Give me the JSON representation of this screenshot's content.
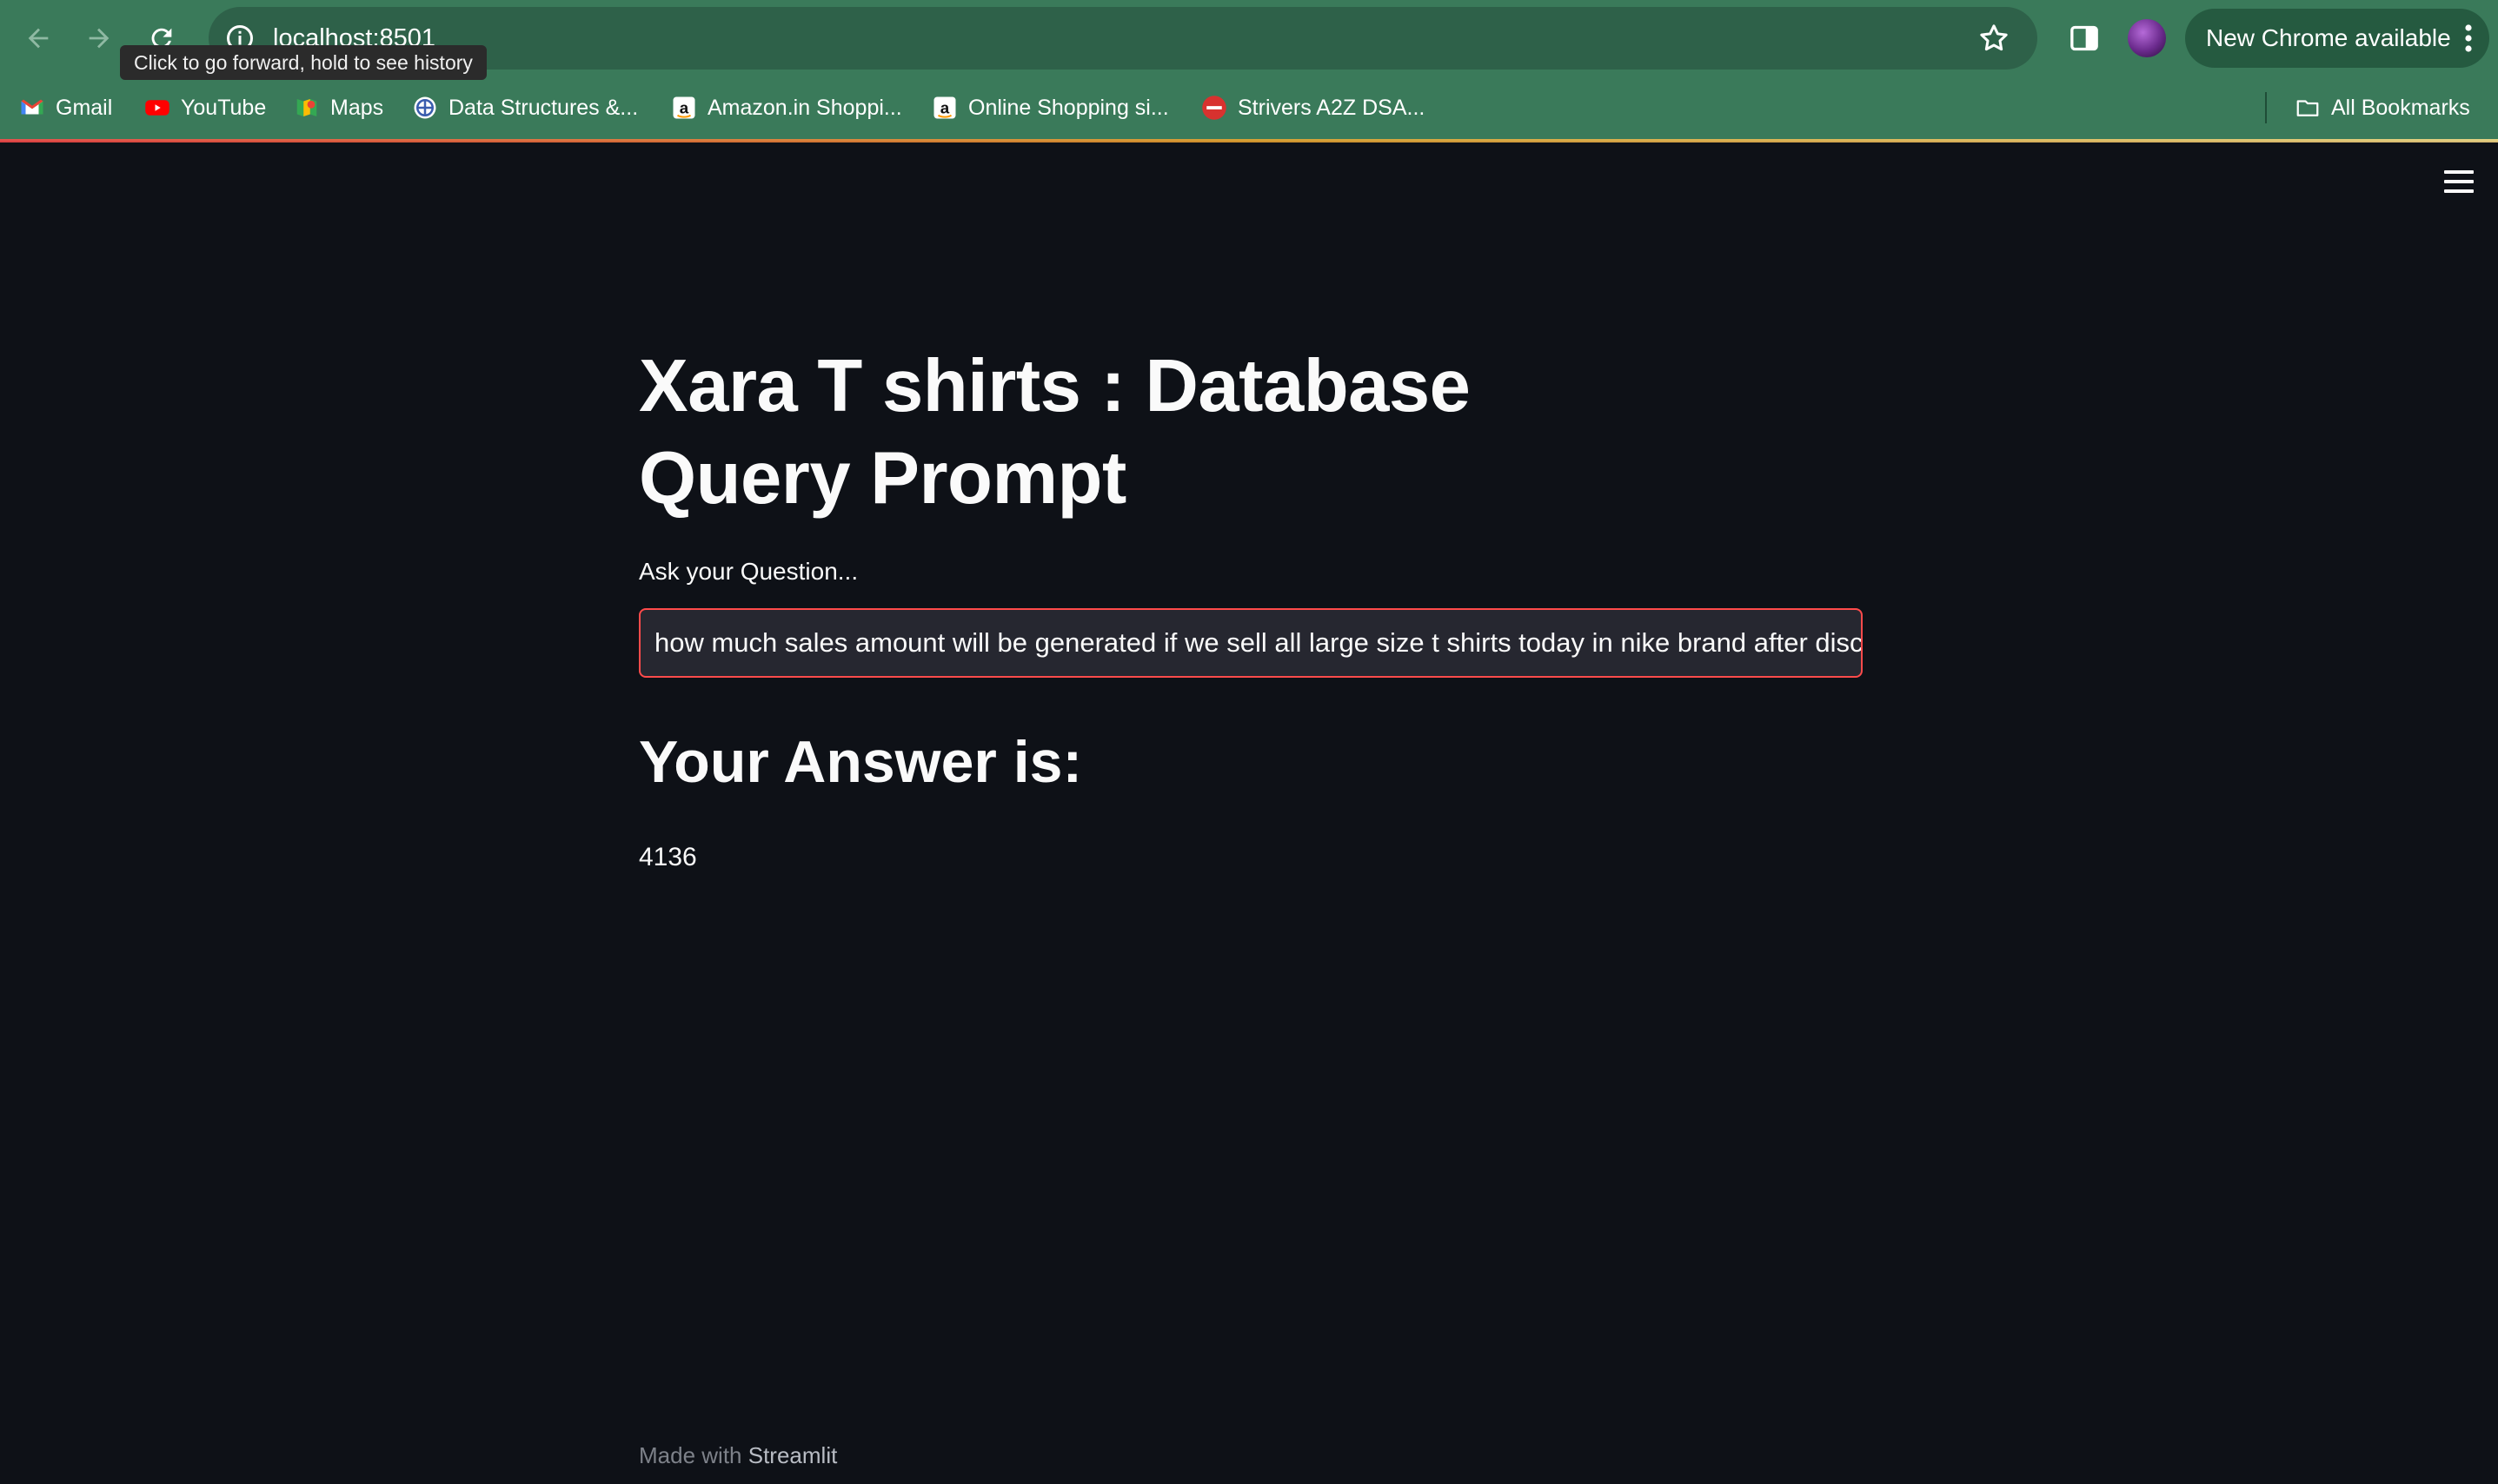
{
  "browser": {
    "url": "localhost:8501",
    "tooltip": "Click to go forward, hold to see history",
    "update_label": "New Chrome available"
  },
  "bookmarks": [
    {
      "label": "Gmail",
      "icon": "gmail-icon"
    },
    {
      "label": "YouTube",
      "icon": "youtube-icon"
    },
    {
      "label": "Maps",
      "icon": "maps-icon"
    },
    {
      "label": "Data Structures &...",
      "icon": "globe-icon"
    },
    {
      "label": "Amazon.in Shoppi...",
      "icon": "amazon-icon"
    },
    {
      "label": "Online Shopping si...",
      "icon": "amazon-icon"
    },
    {
      "label": "Strivers A2Z DSA...",
      "icon": "tuf-icon"
    }
  ],
  "all_bookmarks": "All Bookmarks",
  "app": {
    "title": "Xara T shirts : Database Query Prompt",
    "question_label": "Ask your Question...",
    "question_value": "how much sales amount will be generated if we sell all large size t shirts today in nike brand after discou",
    "answer_heading": "Your Answer is:",
    "answer_value": "4136",
    "footer_prefix": "Made with",
    "footer_brand": "Streamlit"
  },
  "colors": {
    "chrome_green": "#3a7a5a",
    "app_bg": "#0e1117",
    "input_border": "#ff4b4b",
    "text": "#fafafa"
  }
}
